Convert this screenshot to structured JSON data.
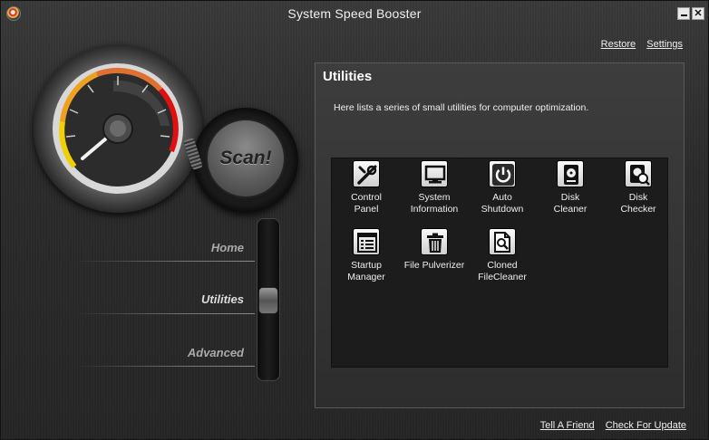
{
  "window": {
    "title": "System Speed Booster"
  },
  "toplinks": {
    "restore": "Restore",
    "settings": "Settings"
  },
  "scan": {
    "label": "Scan!"
  },
  "nav": [
    {
      "label": "Home",
      "active": false
    },
    {
      "label": "Utilities",
      "active": true
    },
    {
      "label": "Advanced",
      "active": false
    }
  ],
  "panel": {
    "title": "Utilities",
    "description": "Here lists a series of small utilities for computer optimization."
  },
  "utilities": [
    {
      "label": "Control\nPanel",
      "icon": "tools-icon"
    },
    {
      "label": "System\nInformation",
      "icon": "monitor-icon"
    },
    {
      "label": "Auto\nShutdown",
      "icon": "power-icon"
    },
    {
      "label": "Disk\nCleaner",
      "icon": "disk-icon"
    },
    {
      "label": "Disk\nChecker",
      "icon": "disk-check-icon"
    },
    {
      "label": "Startup\nManager",
      "icon": "startup-list-icon"
    },
    {
      "label": "File Pulverizer",
      "icon": "trash-icon"
    },
    {
      "label": "Cloned\nFileCleaner",
      "icon": "file-search-icon"
    }
  ],
  "bottomlinks": {
    "tell_friend": "Tell A Friend",
    "check_update": "Check For Update"
  }
}
